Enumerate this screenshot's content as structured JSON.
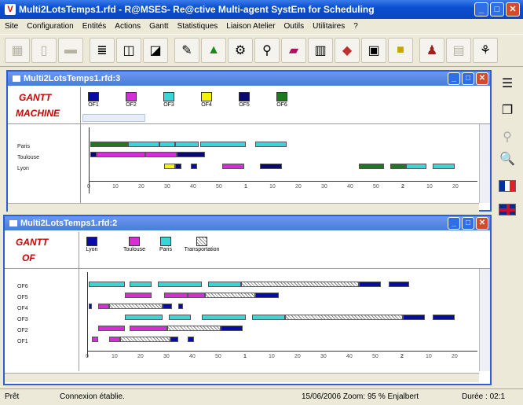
{
  "window": {
    "title": "Multi2LotsTemps1.rfd - R@MSES- Re@ctive Multi-agent SystEm for Scheduling"
  },
  "menu": [
    "Site",
    "Configuration",
    "Entités",
    "Actions",
    "Gantt",
    "Statistiques",
    "Liaison Atelier",
    "Outils",
    "Utilitaires",
    "?"
  ],
  "toolbar_icons": [
    "grid-disabled-icon",
    "new-file-icon",
    "folder-icon",
    "report-icon",
    "chart-window-icon",
    "chart-window-2-icon",
    "pencil-icon",
    "tree-icon",
    "gear-icon",
    "pin-icon",
    "machines-icon",
    "stats-icon",
    "cube-icon",
    "save-icon",
    "open-folder-icon",
    "user-icon",
    "table-disabled-icon",
    "network-icon"
  ],
  "gantt_machine": {
    "window_title": "Multi2LotsTemps1.rfd:3",
    "title_line1": "GANTT",
    "title_line2": "MACHINE",
    "legend": [
      {
        "label": "OF1",
        "color": "#0a0aa8"
      },
      {
        "label": "OF2",
        "color": "#d62ed6"
      },
      {
        "label": "OF3",
        "color": "#38d6d6"
      },
      {
        "label": "OF4",
        "color": "#f2f20a"
      },
      {
        "label": "OF5",
        "color": "#0a0a6e"
      },
      {
        "label": "OF6",
        "color": "#1e7a1e"
      }
    ],
    "rows": [
      "Paris",
      "Toulouse",
      "Lyon"
    ],
    "ticks": [
      "0",
      "10",
      "20",
      "30",
      "40",
      "50",
      "1",
      "10",
      "20",
      "30",
      "40",
      "50",
      "2",
      "10",
      "20"
    ]
  },
  "gantt_of": {
    "window_title": "Multi2LotsTemps1.rfd:2",
    "title_line1": "GANTT",
    "title_line2": "OF",
    "legend": [
      {
        "label": "Lyon",
        "color": "#0a0aa8"
      },
      {
        "label": "Toulouse",
        "color": "#d62ed6"
      },
      {
        "label": "Paris",
        "color": "#38d6d6"
      },
      {
        "label": "Transportation",
        "color": "hatch"
      }
    ],
    "rows": [
      "OF6",
      "OF5",
      "OF4",
      "OF3",
      "OF2",
      "OF1"
    ],
    "ticks": [
      "0",
      "10",
      "20",
      "30",
      "40",
      "50",
      "1",
      "10",
      "20",
      "30",
      "40",
      "50",
      "2",
      "10",
      "20"
    ]
  },
  "status": {
    "ready": "Prêt",
    "connection": "Connexion établie.",
    "info": "15/06/2006  Zoom: 95 %  Enjalbert",
    "duration": "Durée : 02:1"
  }
}
